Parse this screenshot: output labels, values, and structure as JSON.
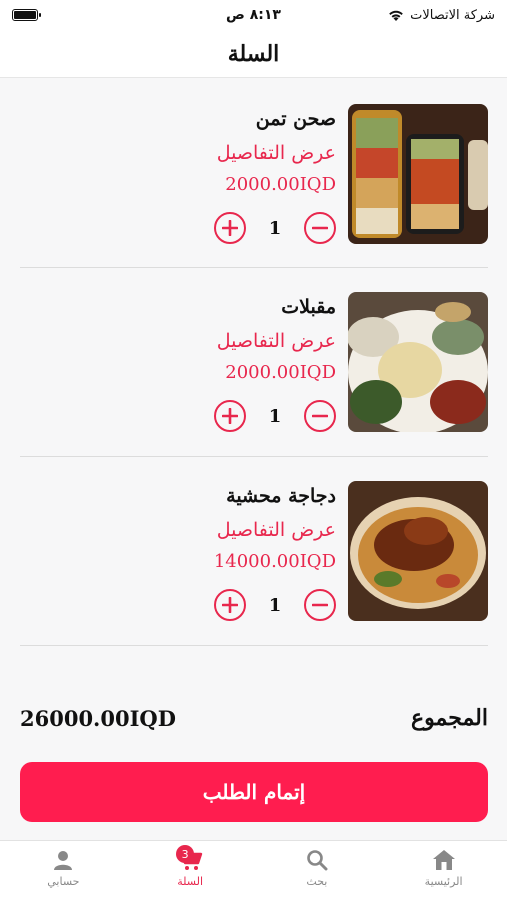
{
  "status_bar": {
    "carrier": "شركة الاتصالات",
    "time": "٨:١٣ ص"
  },
  "header": {
    "title": "السلة"
  },
  "cart": {
    "items": [
      {
        "name": "صحن تمن",
        "details_label": "عرض التفاصيل",
        "price": "2000.00IQD",
        "quantity": "1",
        "image": "rice-dish-photo"
      },
      {
        "name": "مقبلات",
        "details_label": "عرض التفاصيل",
        "price": "2000.00IQD",
        "quantity": "1",
        "image": "appetizers-photo"
      },
      {
        "name": "دجاجة محشية",
        "details_label": "عرض التفاصيل",
        "price": "14000.00IQD",
        "quantity": "1",
        "image": "stuffed-chicken-photo"
      }
    ]
  },
  "summary": {
    "total_label": "المجموع",
    "total_amount": "26000.00IQD",
    "checkout_label": "إتمام الطلب"
  },
  "tab_bar": {
    "tabs": [
      {
        "label": "الرئيسية",
        "icon": "home-icon"
      },
      {
        "label": "بحث",
        "icon": "search-icon"
      },
      {
        "label": "السلة",
        "icon": "cart-icon",
        "badge": "3",
        "active": true
      },
      {
        "label": "حسابي",
        "icon": "person-icon"
      }
    ]
  },
  "colors": {
    "accent": "#e8274d",
    "button": "#ff1d4f"
  }
}
